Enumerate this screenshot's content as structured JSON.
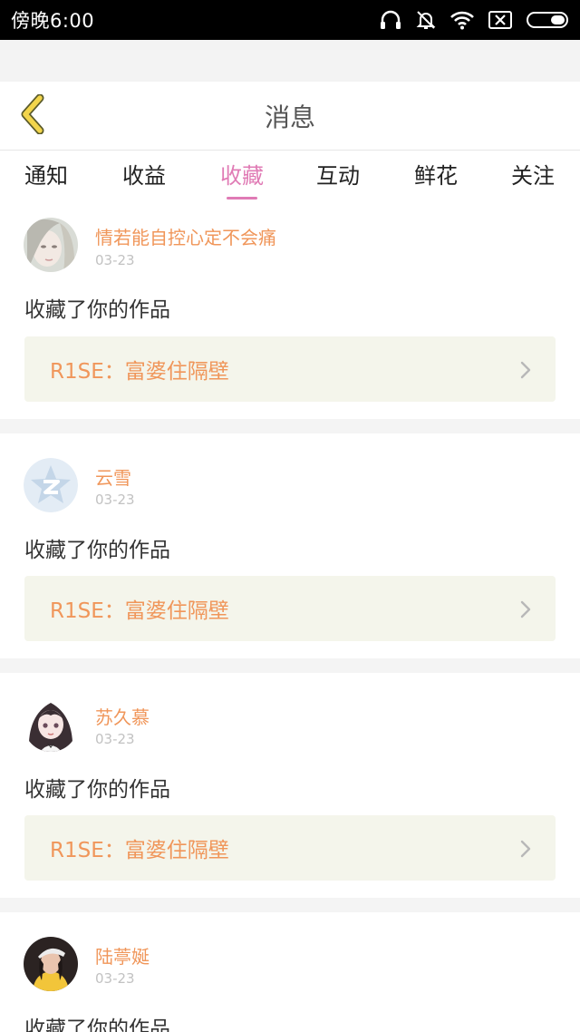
{
  "status_bar": {
    "time": "傍晚6:00",
    "icons": [
      "headphones-icon",
      "mute-bell-icon",
      "wifi-icon",
      "no-sim-icon",
      "battery-icon"
    ]
  },
  "header": {
    "title": "消息",
    "back_icon": "chevron-left-icon"
  },
  "tabs": [
    {
      "label": "通知",
      "active": false
    },
    {
      "label": "收益",
      "active": false
    },
    {
      "label": "收藏",
      "active": true
    },
    {
      "label": "互动",
      "active": false
    },
    {
      "label": "鲜花",
      "active": false
    },
    {
      "label": "关注",
      "active": false
    }
  ],
  "notifications": [
    {
      "username": "情若能自控心定不会痛",
      "date": "03-23",
      "message": "收藏了你的作品",
      "work_title": "R1SE：富婆住隔壁"
    },
    {
      "username": "云雪",
      "date": "03-23",
      "message": "收藏了你的作品",
      "work_title": "R1SE：富婆住隔壁"
    },
    {
      "username": "苏久慕",
      "date": "03-23",
      "message": "收藏了你的作品",
      "work_title": "R1SE：富婆住隔壁"
    },
    {
      "username": "陆葶娫",
      "date": "03-23",
      "message": "收藏了你的作品"
    }
  ],
  "colors": {
    "accent_pink": "#e07bb5",
    "username_orange": "#f0965a",
    "link_bg": "#f4f5eb",
    "date_gray": "#c2c2c2",
    "back_yellow": "#f2d54c"
  }
}
